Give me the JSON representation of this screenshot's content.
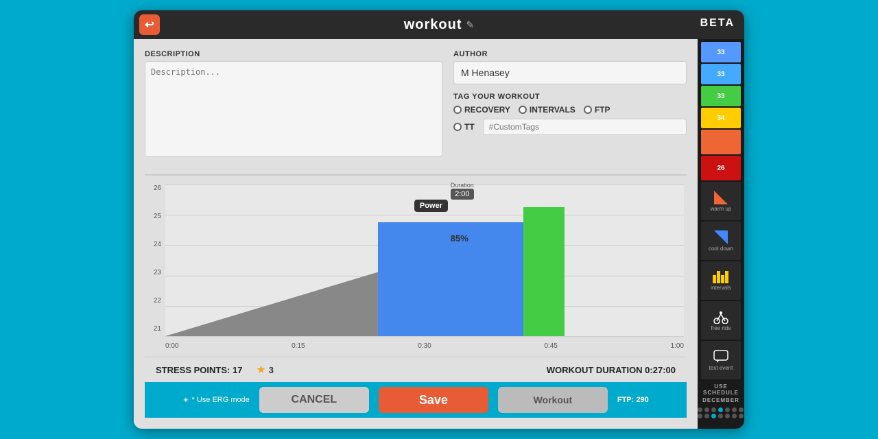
{
  "titleBar": {
    "backLabel": "◀",
    "title": "workout",
    "editIcon": "✎",
    "beta": "BETA"
  },
  "description": {
    "label": "DESCRIPTION",
    "placeholder": "Description..."
  },
  "author": {
    "label": "AUTHOR",
    "value": "M Henasey"
  },
  "tagWorkout": {
    "label": "TAG YOUR WORKOUT",
    "options": [
      "RECOVERY",
      "INTERVALS",
      "FTP",
      "TT"
    ],
    "customTagsPlaceholder": "#CustomTags"
  },
  "chart": {
    "yLabels": [
      "26",
      "25",
      "24",
      "23",
      "22",
      "21"
    ],
    "xLabels": [
      "0:00",
      "0:15",
      "0:30",
      "0:45",
      "1:00"
    ],
    "powerTooltip": "85%",
    "powerLabel": "Power",
    "durationLabel": "Duration",
    "durationValue": "2:00"
  },
  "statusBar": {
    "stressPoints": "STRESS POINTS: 17",
    "rating": "3",
    "workoutDuration": "WORKOUT DURATION 0:27:00",
    "useErgMode": "* Use ERG mode",
    "ftp": "FTP: 290"
  },
  "sidebar": {
    "colors": [
      {
        "color": "#4499ff",
        "value": "33"
      },
      {
        "color": "#4499ff",
        "value": "33"
      },
      {
        "color": "#44cc44",
        "value": "33"
      },
      {
        "color": "#ffcc00",
        "value": "34"
      },
      {
        "color": "#ee6633",
        "value": ""
      },
      {
        "color": "#cc1111",
        "value": "26"
      }
    ],
    "icons": [
      {
        "label": "warm up",
        "shape": "triangle"
      },
      {
        "label": "cool down",
        "shape": "arrow"
      },
      {
        "label": "intervals",
        "shape": "bars"
      },
      {
        "label": "free ride",
        "shape": "bike"
      },
      {
        "label": "text event",
        "shape": "chat"
      }
    ]
  },
  "buttons": {
    "cancel": "Cancel",
    "save": "Save",
    "workout": "Workout"
  },
  "scheduleLabel": "USE SCHEDULE",
  "monthLabel": "DECEMBER"
}
